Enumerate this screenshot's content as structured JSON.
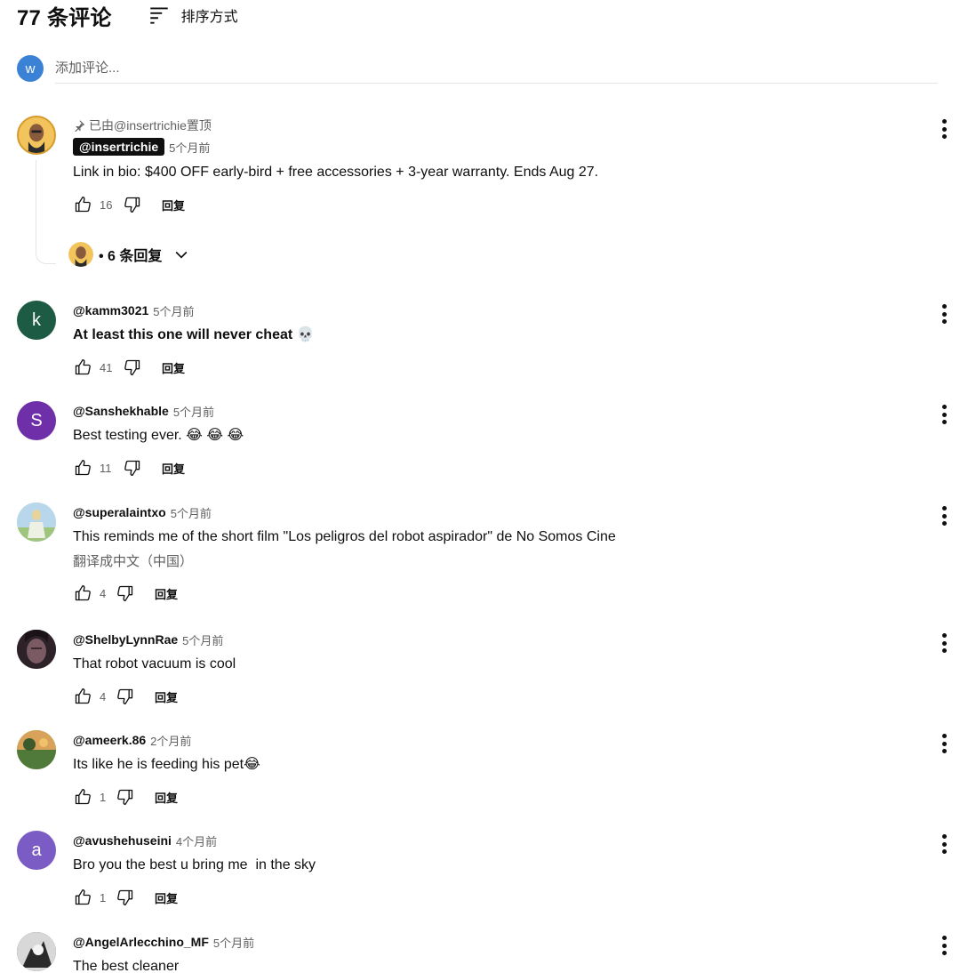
{
  "header": {
    "count_title": "77 条评论",
    "sort_label": "排序方式"
  },
  "add_comment": {
    "avatar_letter": "w",
    "placeholder": "添加评论..."
  },
  "reply_label": "回复",
  "comments": [
    {
      "pinned": "已由@insertrichie置顶",
      "author": "@insertrichie",
      "time": "5个月前",
      "text": "Link in bio: $400 OFF early-bird + free accessories + 3-year warranty. Ends Aug 27.",
      "likes": "16",
      "replies": "• 6 条回复"
    },
    {
      "author": "@kamm3021",
      "time": "5个月前",
      "text": "At least this one will never cheat 💀",
      "likes": "41",
      "avatar_letter": "k",
      "avatar_color": "#1e5b45"
    },
    {
      "author": "@Sanshekhable",
      "time": "5个月前",
      "text": "Best testing ever. 😂 😂 😂",
      "likes": "11",
      "avatar_letter": "S",
      "avatar_color": "#6f2fa8"
    },
    {
      "author": "@superalaintxo",
      "time": "5个月前",
      "text": "This reminds me of the short film \"Los peligros del robot aspirador\" de No Somos Cine",
      "translate": "翻译成中文（中国）",
      "likes": "4"
    },
    {
      "author": "@ShelbyLynnRae",
      "time": "5个月前",
      "text": "That robot vacuum is cool",
      "likes": "4"
    },
    {
      "author": "@ameerk.86",
      "time": "2个月前",
      "text": "Its like he is feeding his pet😂",
      "likes": "1"
    },
    {
      "author": "@avushehuseini",
      "time": "4个月前",
      "text": "Bro you the best u bring me  in the sky",
      "likes": "1",
      "avatar_letter": "a",
      "avatar_color": "#7b5cc4"
    },
    {
      "author": "@AngelArlecchino_MF",
      "time": "5个月前",
      "text": "The best cleaner"
    }
  ]
}
